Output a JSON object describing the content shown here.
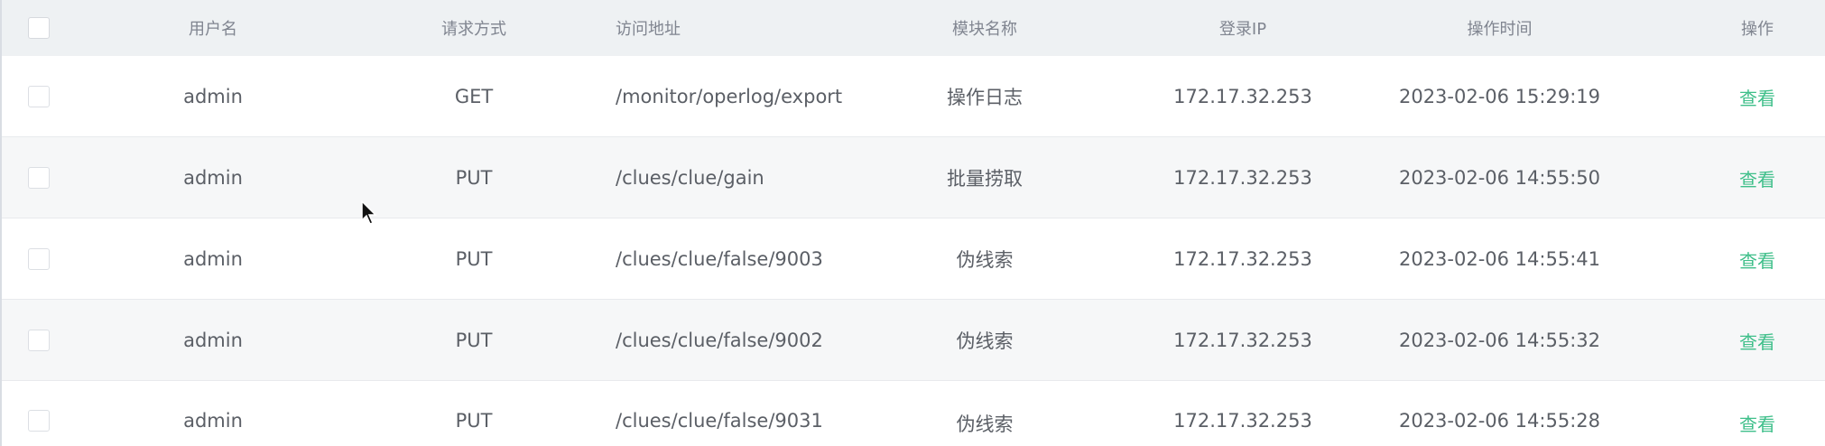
{
  "table": {
    "headers": {
      "username": "用户名",
      "method": "请求方式",
      "url": "访问地址",
      "module": "模块名称",
      "ip": "登录IP",
      "time": "操作时间",
      "action": "操作"
    },
    "rows": [
      {
        "username": "admin",
        "method": "GET",
        "url": "/monitor/operlog/export",
        "module": "操作日志",
        "ip": "172.17.32.253",
        "time": "2023-02-06 15:29:19",
        "action": "查看"
      },
      {
        "username": "admin",
        "method": "PUT",
        "url": "/clues/clue/gain",
        "module": "批量捞取",
        "ip": "172.17.32.253",
        "time": "2023-02-06 14:55:50",
        "action": "查看"
      },
      {
        "username": "admin",
        "method": "PUT",
        "url": "/clues/clue/false/9003",
        "module": "伪线索",
        "ip": "172.17.32.253",
        "time": "2023-02-06 14:55:41",
        "action": "查看"
      },
      {
        "username": "admin",
        "method": "PUT",
        "url": "/clues/clue/false/9002",
        "module": "伪线索",
        "ip": "172.17.32.253",
        "time": "2023-02-06 14:55:32",
        "action": "查看"
      },
      {
        "username": "admin",
        "method": "PUT",
        "url": "/clues/clue/false/9031",
        "module": "伪线索",
        "ip": "172.17.32.253",
        "time": "2023-02-06 14:55:28",
        "action": "查看"
      }
    ]
  },
  "colors": {
    "header_bg": "#eef1f3",
    "link": "#3fbf8a",
    "row_alt": "#f6f7f8"
  },
  "icons": {
    "cursor": "mouse-pointer-icon"
  }
}
